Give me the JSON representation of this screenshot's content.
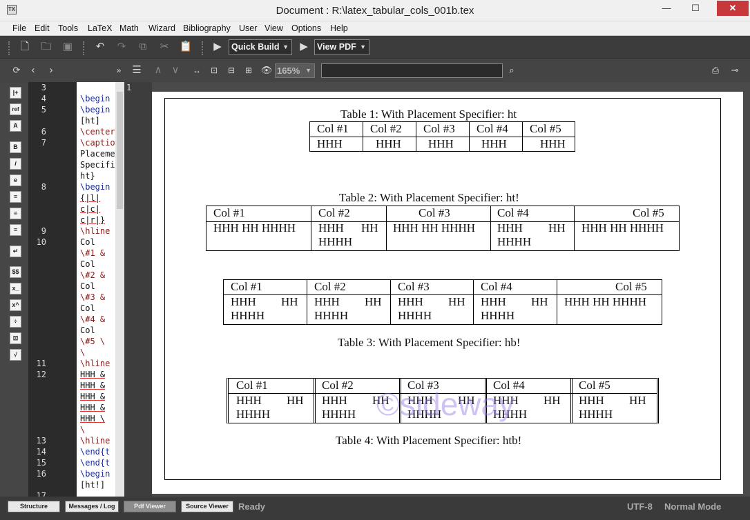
{
  "window": {
    "title": "Document : R:\\latex_tabular_cols_001b.tex",
    "min": "—",
    "max": "☐",
    "close": "✕"
  },
  "menu": [
    "File",
    "Edit",
    "Tools",
    "LaTeX",
    "Math",
    "Wizard",
    "Bibliography",
    "User",
    "View",
    "Options",
    "Help"
  ],
  "toolbar": {
    "quick_build": "Quick Build",
    "view_pdf": "View PDF"
  },
  "pdf_toolbar": {
    "zoom": "165%",
    "search_value": ""
  },
  "left_icons": [
    "|+",
    "ref",
    "A",
    "B",
    "i",
    "e",
    "≡",
    "≡",
    "≡",
    "↵",
    "$$",
    "x_",
    "x^",
    "÷",
    "⊡",
    "√"
  ],
  "editor": {
    "line_numbers": [
      "3",
      "4",
      "5",
      "6",
      "7",
      "8",
      "9",
      "10",
      "11",
      "12",
      "13",
      "14",
      "15",
      "16",
      "17"
    ],
    "lines": [
      "\\begin",
      "\\begin",
      "[ht]",
      "\\center",
      "\\captio",
      "Placeme",
      "Specifi",
      "ht}",
      "\\begin",
      "{|l|",
      "c|c|",
      "c|r|}",
      "\\hline",
      "Col",
      "\\#1 &",
      "Col",
      "\\#2 &",
      "Col",
      "\\#3 &",
      "Col",
      "\\#4 &",
      "Col",
      "\\#5 \\",
      "\\",
      "\\hline",
      "HHH &",
      "HHH &",
      "HHH &",
      "HHH &",
      "HHH \\",
      "\\",
      "\\hline",
      "\\end{t",
      "\\end{t",
      "\\begin",
      "[ht!]"
    ]
  },
  "pdf": {
    "page_number": "1",
    "table1": {
      "caption": "Table 1: With Placement Specifier: ht",
      "headers": [
        "Col #1",
        "Col #2",
        "Col #3",
        "Col #4",
        "Col #5"
      ],
      "row": [
        "HHH",
        "HHH",
        "HHH",
        "HHH",
        "HHH"
      ]
    },
    "table2": {
      "caption": "Table 2: With Placement Specifier: ht!",
      "headers": [
        "Col #1",
        "Col #2",
        "Col #3",
        "Col #4",
        "Col #5"
      ],
      "row1": [
        "HHH HH HHHH",
        "HHH",
        "HHH HH HHHH",
        "HHH",
        "HHH HH HHHH"
      ],
      "row1b": [
        "",
        "HH",
        "",
        "HH",
        ""
      ],
      "row2": [
        "",
        "HHHH",
        "",
        "HHHH",
        ""
      ]
    },
    "table3": {
      "caption": "Table 3: With Placement Specifier: hb!",
      "headers": [
        "Col #1",
        "Col #2",
        "Col #3",
        "Col #4",
        "Col #5"
      ],
      "row1": [
        "HHH",
        "HHH",
        "HHH",
        "HHH",
        "HHH HH HHHH"
      ],
      "row1b": [
        "HH",
        "HH",
        "HH",
        "HH",
        ""
      ],
      "row2": [
        "HHHH",
        "HHHH",
        "HHHH",
        "HHHH",
        ""
      ]
    },
    "table4": {
      "caption": "Table 4: With Placement Specifier: htb!",
      "headers": [
        "Col #1",
        "Col #2",
        "Col #3",
        "Col #4",
        "Col #5"
      ],
      "row1": [
        "HHH",
        "HHH",
        "HHH",
        "HHH",
        "HHH"
      ],
      "row1b": [
        "HH",
        "HH",
        "HH",
        "HH",
        "HH"
      ],
      "row2": [
        "HHHH",
        "HHHH",
        "HHHH",
        "HHHH",
        "HHHH"
      ]
    },
    "watermark": "©sideway"
  },
  "status": {
    "tabs": [
      "Structure",
      "Messages / Log",
      "Pdf Viewer",
      "Source Viewer"
    ],
    "ready": "Ready",
    "encoding": "UTF-8",
    "mode": "Normal Mode"
  }
}
